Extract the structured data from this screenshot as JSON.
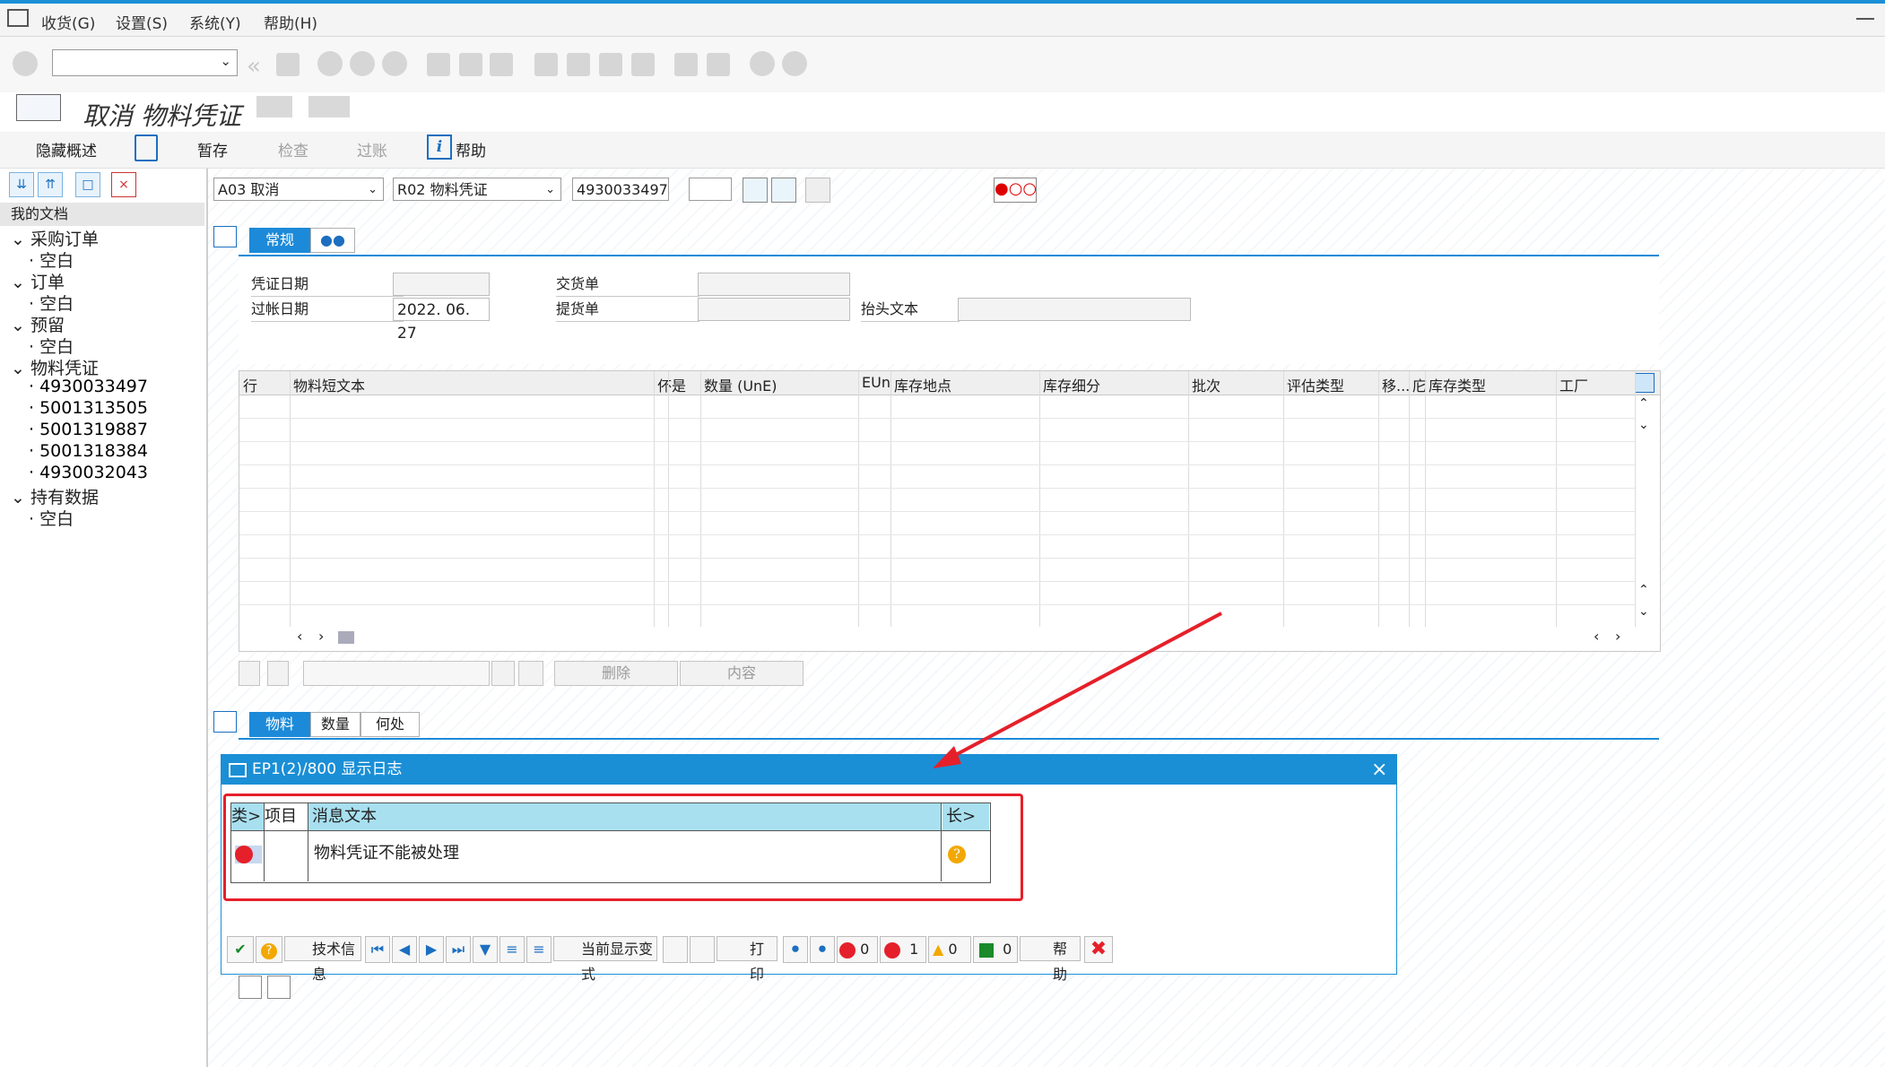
{
  "menu": {
    "items": [
      "收货(G)",
      "设置(S)",
      "系统(Y)",
      "帮助(H)"
    ]
  },
  "title": "取消 物料凭证",
  "toolbar": {
    "hide_overview": "隐藏概述",
    "hold": "暂存",
    "check": "检查",
    "post": "过账",
    "help": "帮助"
  },
  "sidebar": {
    "header": "我的文档",
    "nodes": [
      {
        "label": "采购订单",
        "children": [
          "空白"
        ]
      },
      {
        "label": "订单",
        "children": [
          "空白"
        ]
      },
      {
        "label": "预留",
        "children": [
          "空白"
        ]
      },
      {
        "label": "物料凭证",
        "children": [
          "4930033497",
          "5001313505",
          "5001319887",
          "5001318384",
          "4930032043"
        ]
      },
      {
        "label": "持有数据",
        "children": [
          "空白"
        ]
      }
    ]
  },
  "header_fields": {
    "action": "A03 取消",
    "ref_doc": "R02 物料凭证",
    "doc_number": "4930033497"
  },
  "tabs_top": {
    "general": "常规"
  },
  "form": {
    "doc_date_label": "凭证日期",
    "post_date_label": "过帐日期",
    "post_date_value": "2022. 06. 27",
    "delivery_label": "交货单",
    "bol_label": "提货单",
    "header_text_label": "抬头文本"
  },
  "grid": {
    "columns": [
      "行",
      "物料短文本",
      "伓",
      "是",
      "数量 (UnE)",
      "EUn",
      "库存地点",
      "库存细分",
      "批次",
      "评估类型",
      "移...",
      "庀",
      "库存类型",
      "工厂"
    ]
  },
  "grid_buttons": {
    "delete": "删除",
    "content": "内容"
  },
  "tabs_bottom": {
    "material": "物料",
    "quantity": "数量",
    "where": "何处"
  },
  "dialog": {
    "title": "EP1(2)/800 显示日志",
    "col_type": "类>",
    "col_item": "项目",
    "col_msg": "消息文本",
    "col_long": "长>",
    "message": "物料凭证不能被处理",
    "buttons": {
      "tech_info": "技术信息",
      "current_variant": "当前显示变式",
      "print": "打印",
      "stop_count": "0",
      "error_count": "1",
      "warn_count": "0",
      "ok_count": "0",
      "help": "帮助"
    }
  },
  "colors": {
    "accent": "#1a8fd6",
    "highlight": "#e5202a",
    "header_cell": "#a8e0f0"
  }
}
